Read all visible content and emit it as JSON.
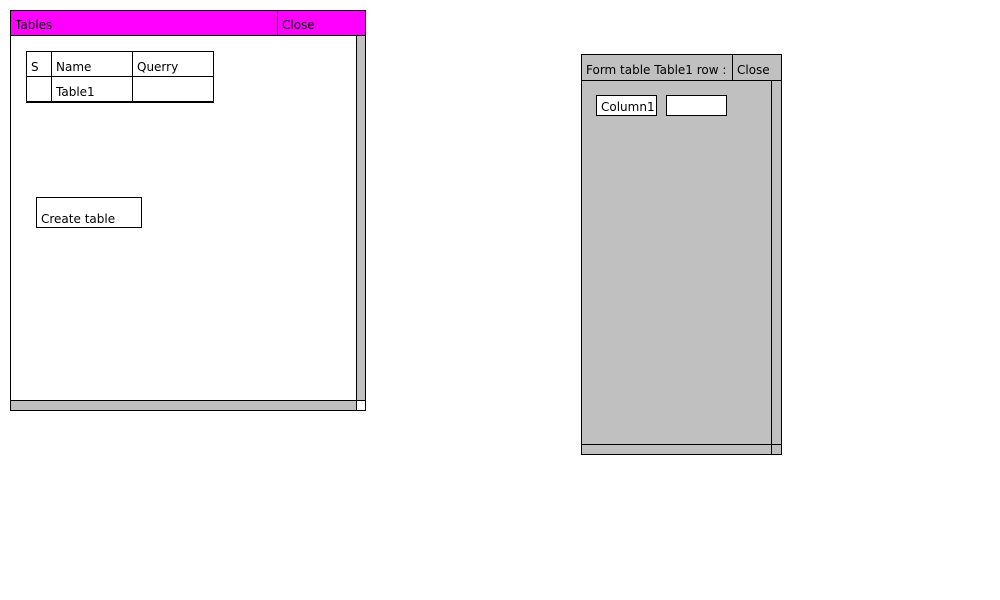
{
  "colors": {
    "tables_titlebar": "#ff00ff",
    "panel_gray": "#c0c0c0"
  },
  "tables_window": {
    "title": "Tables",
    "close_label": "Close",
    "table": {
      "headers": [
        "S",
        "Name",
        "Querry"
      ],
      "rows": [
        [
          "",
          "Table1",
          ""
        ]
      ]
    },
    "create_button_label": "Create table"
  },
  "form_window": {
    "title": "Form table Table1 row :",
    "close_label": "Close",
    "fields": [
      {
        "label": "Column1",
        "value": ""
      }
    ]
  }
}
